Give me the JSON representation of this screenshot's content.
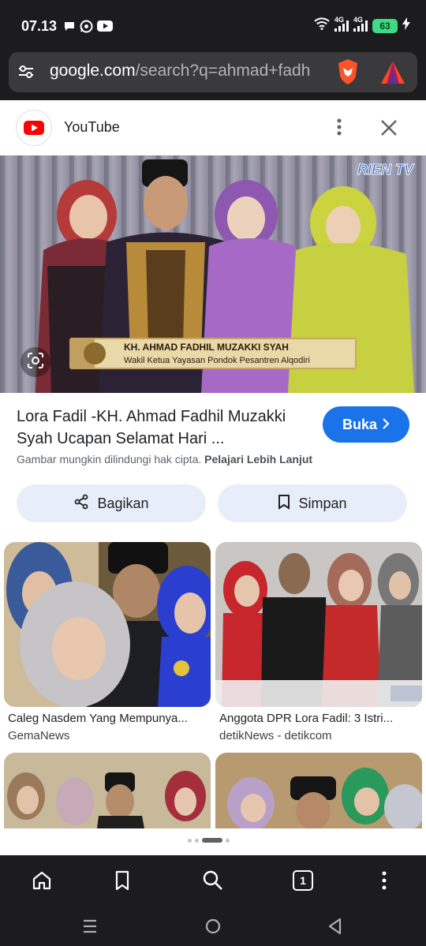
{
  "status_bar": {
    "time": "07.13",
    "net1": "4G",
    "net2": "4G",
    "battery": "63"
  },
  "url_bar": {
    "host": "google.com",
    "path": "/search?q=ahmad+fadh"
  },
  "source": {
    "name": "YouTube"
  },
  "hero": {
    "channel_logo": "RIEN TV",
    "caption_title": "KH. AHMAD FADHIL MUZAKKI SYAH",
    "caption_subtitle": "Wakil Ketua Yayasan Pondok Pesantren Alqodiri"
  },
  "result": {
    "title": "Lora Fadil -KH. Ahmad Fadhil Muzakki Syah Ucapan Selamat Hari ...",
    "open_label": "Buka",
    "copyright_text": "Gambar mungkin dilindungi hak cipta.",
    "learn_more": "Pelajari Lebih Lanjut",
    "share_label": "Bagikan",
    "save_label": "Simpan"
  },
  "related": [
    {
      "caption": "Caleg Nasdem Yang Mempunya...",
      "source": "GemaNews"
    },
    {
      "caption": "Anggota DPR Lora Fadil: 3 Istri...",
      "source": "detikNews - detikcom"
    }
  ],
  "toolbar": {
    "tab_count": "1"
  },
  "colors": {
    "accent": "#1a73e8",
    "chrome": "#1c1c1e",
    "chip": "#e8eef9"
  }
}
